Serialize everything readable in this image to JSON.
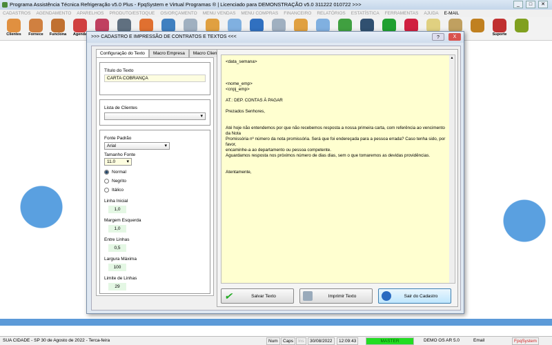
{
  "window": {
    "title": "Programa Assistência Técnica Refrigeração v5.0 Plus - FpqSystem e Virtual Programas ® | Licenciado para  DEMONSTRAÇÃO v5.0 311222 010722 >>>",
    "controls": [
      "_",
      "□",
      "✕"
    ]
  },
  "menu": [
    "CADASTROS",
    "AGENDAMENTO",
    "APARELHOS",
    "PRODUTO/ESTOQUE",
    "OS/ORÇAMENTO",
    "MENU VENDAS",
    "MENU COMPRAS",
    "FINANCEIRO",
    "RELATÓRIOS",
    "ESTATÍSTICA",
    "FERRAMENTAS",
    "AJUDA",
    "E-MAIL"
  ],
  "toolbar": [
    {
      "label": "Clientes",
      "color": "#e09040"
    },
    {
      "label": "Fornece",
      "color": "#d08040"
    },
    {
      "label": "Funciona",
      "color": "#c07030"
    },
    {
      "label": "Agenda",
      "color": "#d04040"
    },
    {
      "label": "",
      "color": "#c04060"
    },
    {
      "label": "",
      "color": "#607080"
    },
    {
      "label": "",
      "color": "#e07030"
    },
    {
      "label": "",
      "color": "#4080c0"
    },
    {
      "label": "",
      "color": "#a0b0c0"
    },
    {
      "label": "",
      "color": "#e0a040"
    },
    {
      "label": "",
      "color": "#80b0e0"
    },
    {
      "label": "",
      "color": "#3070c0"
    },
    {
      "label": "",
      "color": "#a0b0c0"
    },
    {
      "label": "",
      "color": "#e0a040"
    },
    {
      "label": "",
      "color": "#80b0e0"
    },
    {
      "label": "",
      "color": "#40a040"
    },
    {
      "label": "",
      "color": "#305070"
    },
    {
      "label": "",
      "color": "#20a030"
    },
    {
      "label": "",
      "color": "#d02040"
    },
    {
      "label": "",
      "color": "#e0d080"
    },
    {
      "label": "",
      "color": "#c0a060"
    },
    {
      "label": "",
      "color": "#c08020"
    },
    {
      "label": "Suporte",
      "color": "#c03030"
    },
    {
      "label": "",
      "color": "#80a020"
    }
  ],
  "dialog": {
    "title": ">>>  CADASTRO E IMPRESSÃO DE CONTRATOS E TEXTOS  <<<",
    "help": "?",
    "close": "X",
    "tabs": [
      "Configuração do Texto",
      "Macro Empresa",
      "Macro Cliente"
    ],
    "titulo_label": "Título do Texto",
    "titulo_value": "CARTA COBRANÇA",
    "lista_label": "Lista de Clientes",
    "lista_value": "",
    "fonte_label": "Fonte Padrão",
    "fonte_value": "Arial",
    "tamanho_label": "Tamanho Fonte",
    "tamanho_value": "11.0",
    "styles": [
      "Normal",
      "Negrito",
      "Itálico"
    ],
    "style_selected": "Normal",
    "linha_inicial_label": "Linha Inicial",
    "linha_inicial": "1,0",
    "margem_label": "Margem Esquerda",
    "margem": "1,0",
    "entre_label": "Entre Linhas",
    "entre": "0,5",
    "largura_label": "Largura Máxima",
    "largura": "100",
    "limite_label": "Limite de Linhas",
    "limite": "29",
    "editor_lines": [
      "<data_semana>",
      "",
      "",
      "",
      "<nome_emp>",
      "<cnpj_emp>",
      "",
      "AT.: DEP. CONTAS À PAGAR",
      "",
      "Prezados Senhores,",
      "",
      "",
      "Até hoje não entendemos por que não recebemos resposta a nossa primeira carta, com referência ao vencimento da Nota",
      "Promissória nº número da nota promissória. Será que foi endereçada para a pessoa errada? Caso tenha sido, por favor,",
      "encaminhe-a ao departamento ou pessoa competente.",
      "Aguardamos resposta nos próximos número de dias dias, sem o que tomaremos as devidas providências.",
      "",
      "",
      "Atentamente,"
    ],
    "buttons": {
      "save": "Salvar Texto",
      "print": "Imprimir Texto",
      "exit": "Sair do Cadastro"
    }
  },
  "status": {
    "city": "SUA CIDADE - SP 30 de Agosto de 2022 - Terca-feira",
    "num": "Num",
    "caps": "Caps",
    "ins": "Ins",
    "date": "30/08/2022",
    "time": "12:09:43",
    "user": "MASTER",
    "demo": "DEMO OS AR 5.0",
    "email": "Email",
    "brand": "FpqSystem",
    "user_color": "#22dd22",
    "brand_color": "#cc2222"
  }
}
